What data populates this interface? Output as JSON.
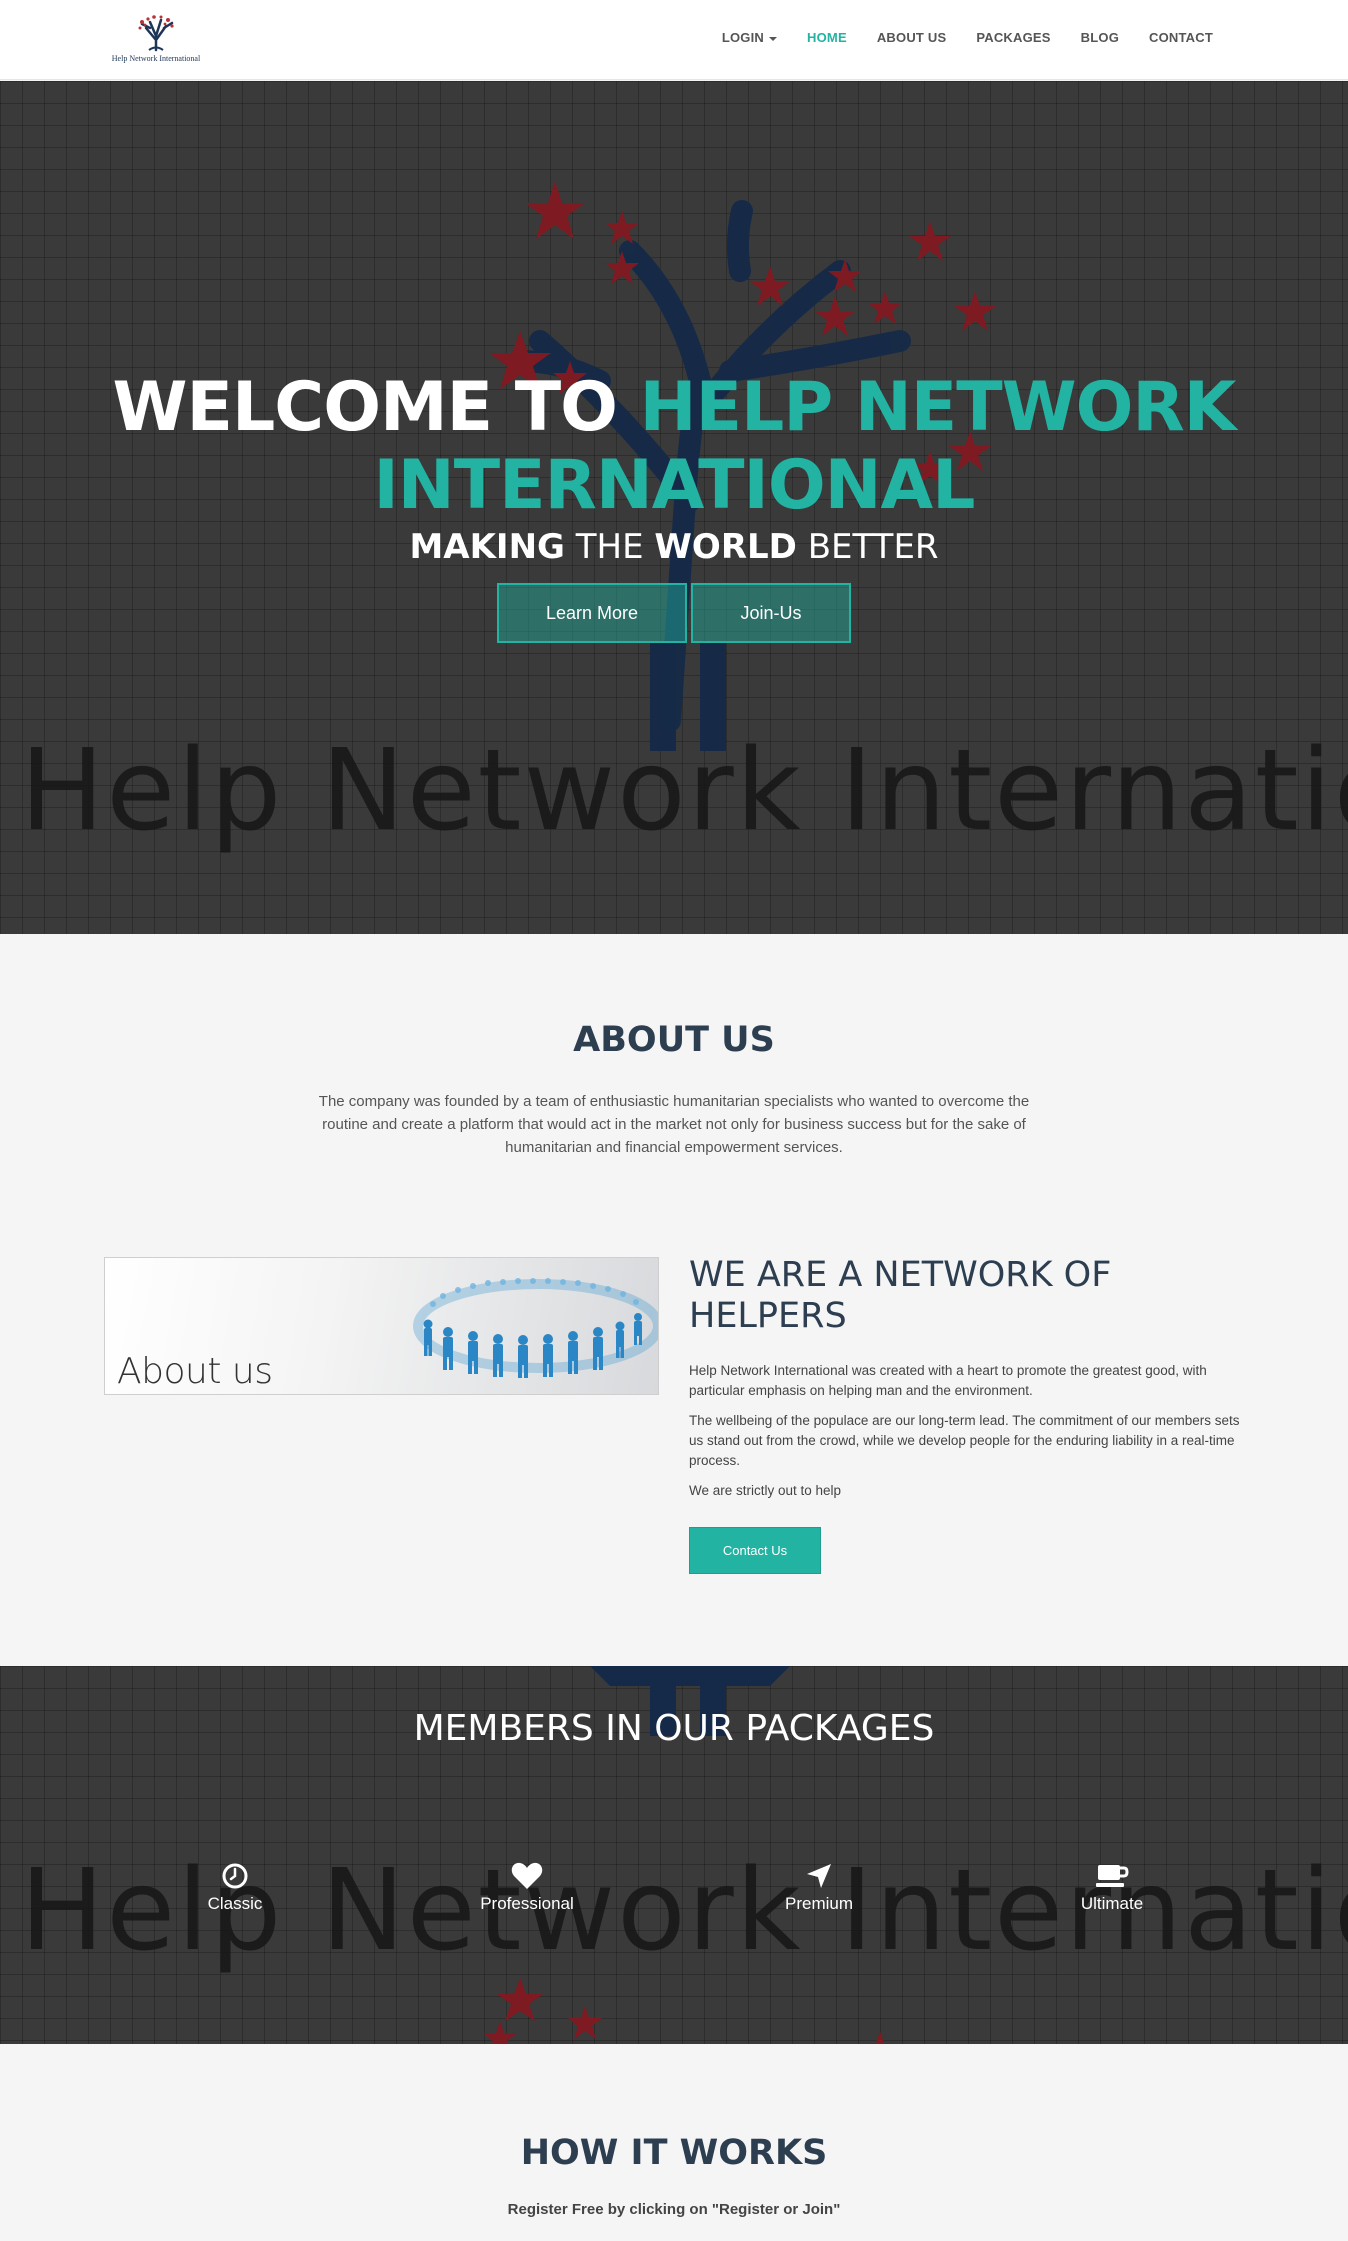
{
  "brand": {
    "logo_icon": "tree-logo-icon",
    "name": "Help Network International"
  },
  "nav": {
    "items": [
      {
        "label": "LOGIN",
        "has_caret": true
      },
      {
        "label": "HOME",
        "active": true
      },
      {
        "label": "ABOUT US"
      },
      {
        "label": "PACKAGES"
      },
      {
        "label": "BLOG"
      },
      {
        "label": "CONTACT"
      }
    ]
  },
  "hero": {
    "title_white": "WELCOME TO",
    "title_accent": "HELP NETWORK INTERNATIONAL",
    "subtitle": {
      "w1": "MAKING",
      "w2": "THE",
      "w3": "WORLD",
      "w4": "BETTER"
    },
    "watermark": "Help Network Internation",
    "learn_more": "Learn More",
    "join_us": "Join-Us"
  },
  "about": {
    "title": "ABOUT US",
    "text": "The company was founded by a team of enthusiastic humanitarian specialists who wanted to overcome the routine and create a platform that would act in the market not only for business success but for the sake of humanitarian and financial empowerment services.",
    "image_label": "About us",
    "helpers_title": "WE ARE A NETWORK OF HELPERS",
    "p1": "Help Network International was created with a heart to promote the greatest good, with particular emphasis on helping man and the environment.",
    "p2": "The wellbeing of the populace are our long-term lead. The commitment of our members sets us stand out from the crowd, while we develop people for the enduring liability in a real-time process.",
    "p3": "We are strictly out to help",
    "contact_button": "Contact Us"
  },
  "members": {
    "title": "MEMBERS IN OUR PACKAGES",
    "packages": [
      {
        "label": "Classic",
        "icon": "clock-icon"
      },
      {
        "label": "Professional",
        "icon": "heart-icon"
      },
      {
        "label": "Premium",
        "icon": "location-arrow-icon"
      },
      {
        "label": "Ultimate",
        "icon": "coffee-cup-icon"
      }
    ]
  },
  "how": {
    "title": "HOW IT WORKS",
    "subtitle": "Register Free by clicking on \"Register or Join\""
  },
  "colors": {
    "accent": "#22b3a2",
    "heading": "#2c3e50",
    "dark_bg": "#3a3a3a",
    "star_red": "#8b1d24",
    "tree_blue": "#1d3557"
  }
}
